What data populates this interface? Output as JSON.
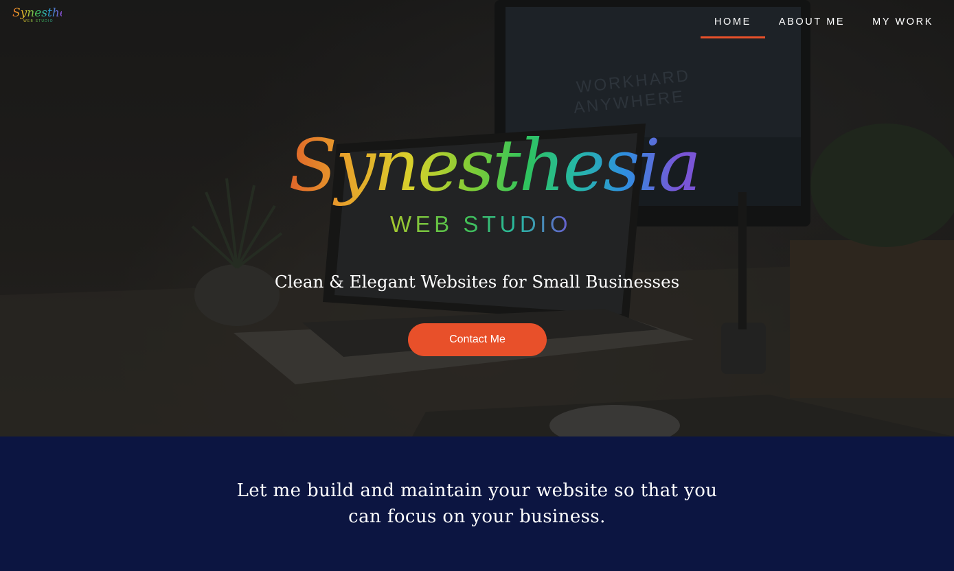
{
  "brand": {
    "logo_script": "Synesthesia",
    "logo_sub": "WEB STUDIO"
  },
  "nav": {
    "items": [
      {
        "label": "HOME",
        "active": true
      },
      {
        "label": "ABOUT ME",
        "active": false
      },
      {
        "label": "MY WORK",
        "active": false
      }
    ]
  },
  "hero": {
    "tagline": "Clean & Elegant Websites for Small Businesses",
    "cta_label": "Contact Me",
    "monitor_text_line1": "WORKHARD",
    "monitor_text_line2": "ANYWHERE"
  },
  "banner": {
    "text": "Let me build and maintain your website so that you can focus on your business."
  },
  "colors": {
    "accent": "#e8502a",
    "navy": "#0c1541",
    "overlay": "#1f1e1d"
  }
}
